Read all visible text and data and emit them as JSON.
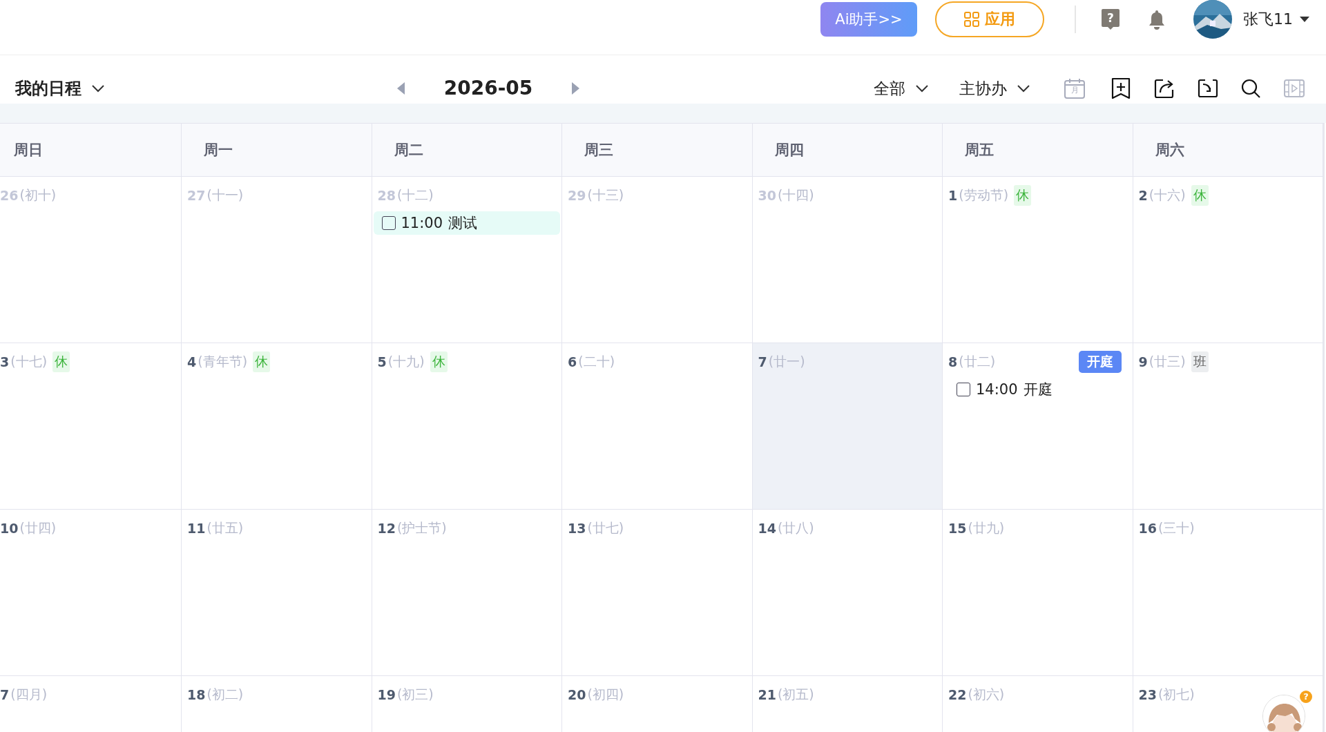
{
  "topbar": {
    "ai_button": "Ai助手>>",
    "apps_button": "应用",
    "help_glyph": "?",
    "user_name": "张飞11"
  },
  "toolbar": {
    "calendar_menu": "我的日程",
    "month": "2026-05",
    "filters": [
      "全部",
      "主协办"
    ],
    "month_icon_label": "月"
  },
  "weekdays": [
    "周日",
    "周一",
    "周二",
    "周三",
    "周四",
    "周五",
    "周六"
  ],
  "weeks": [
    [
      {
        "day": "26",
        "lunar": "(初十)",
        "other_month": true
      },
      {
        "day": "27",
        "lunar": "(十一)",
        "other_month": true
      },
      {
        "day": "28",
        "lunar": "(十二)",
        "other_month": true,
        "events": [
          {
            "time": "11:00",
            "title": "测试",
            "checked": false,
            "tinted": true
          }
        ]
      },
      {
        "day": "29",
        "lunar": "(十三)",
        "other_month": true
      },
      {
        "day": "30",
        "lunar": "(十四)",
        "other_month": true
      },
      {
        "day": "1",
        "lunar": "(劳动节)",
        "other_month": false,
        "badge": {
          "kind": "rest",
          "text": "休"
        }
      },
      {
        "day": "2",
        "lunar": "(十六)",
        "other_month": false,
        "badge": {
          "kind": "rest",
          "text": "休"
        }
      }
    ],
    [
      {
        "day": "3",
        "lunar": "(十七)",
        "other_month": false,
        "badge": {
          "kind": "rest",
          "text": "休"
        }
      },
      {
        "day": "4",
        "lunar": "(青年节)",
        "other_month": false,
        "badge": {
          "kind": "rest",
          "text": "休"
        }
      },
      {
        "day": "5",
        "lunar": "(十九)",
        "other_month": false,
        "badge": {
          "kind": "rest",
          "text": "休"
        }
      },
      {
        "day": "6",
        "lunar": "(二十)",
        "other_month": false
      },
      {
        "day": "7",
        "lunar": "(廿一)",
        "other_month": false,
        "highlighted": true
      },
      {
        "day": "8",
        "lunar": "(廿二)",
        "other_month": false,
        "tag": "开庭",
        "events": [
          {
            "time": "14:00",
            "title": "开庭",
            "checked": false,
            "tinted": false
          }
        ]
      },
      {
        "day": "9",
        "lunar": "(廿三)",
        "other_month": false,
        "badge": {
          "kind": "work",
          "text": "班"
        }
      }
    ],
    [
      {
        "day": "10",
        "lunar": "(廿四)",
        "other_month": false
      },
      {
        "day": "11",
        "lunar": "(廿五)",
        "other_month": false
      },
      {
        "day": "12",
        "lunar": "(护士节)",
        "other_month": false
      },
      {
        "day": "13",
        "lunar": "(廿七)",
        "other_month": false
      },
      {
        "day": "14",
        "lunar": "(廿八)",
        "other_month": false
      },
      {
        "day": "15",
        "lunar": "(廿九)",
        "other_month": false
      },
      {
        "day": "16",
        "lunar": "(三十)",
        "other_month": false
      }
    ],
    [
      {
        "day": "7",
        "lunar": "(四月)",
        "other_month": false
      },
      {
        "day": "18",
        "lunar": "(初二)",
        "other_month": false
      },
      {
        "day": "19",
        "lunar": "(初三)",
        "other_month": false
      },
      {
        "day": "20",
        "lunar": "(初四)",
        "other_month": false
      },
      {
        "day": "21",
        "lunar": "(初五)",
        "other_month": false
      },
      {
        "day": "22",
        "lunar": "(初六)",
        "other_month": false
      },
      {
        "day": "23",
        "lunar": "(初七)",
        "other_month": false
      }
    ]
  ],
  "assistant": {
    "badge": "?"
  }
}
